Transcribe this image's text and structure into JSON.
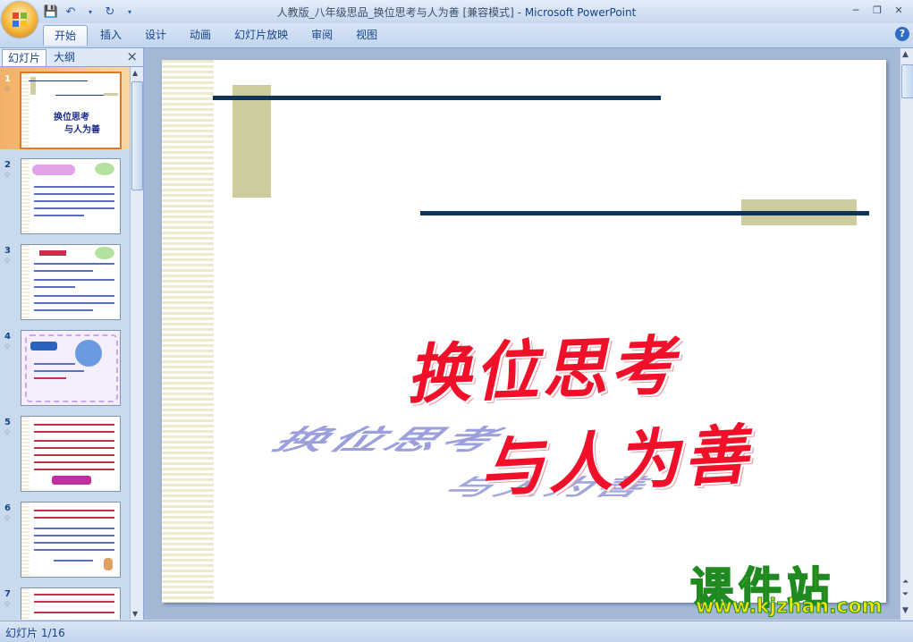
{
  "window": {
    "title": "人教版_八年级思品_换位思考与人为善 [兼容模式]",
    "app_name": "Microsoft PowerPoint"
  },
  "ribbon": {
    "tabs": [
      {
        "label": "开始",
        "active": true
      },
      {
        "label": "插入"
      },
      {
        "label": "设计"
      },
      {
        "label": "动画"
      },
      {
        "label": "幻灯片放映"
      },
      {
        "label": "审阅"
      },
      {
        "label": "视图"
      }
    ]
  },
  "left_panel": {
    "tab_slides": "幻灯片",
    "tab_outline": "大纲",
    "slides": [
      {
        "number": "1",
        "caption": "换位思考 与人为善"
      },
      {
        "number": "2",
        "caption": "案例分析"
      },
      {
        "number": "3",
        "caption": "想一想"
      },
      {
        "number": "4",
        "caption": "七嘴八舌"
      },
      {
        "number": "5",
        "caption": ""
      },
      {
        "number": "6",
        "caption": ""
      },
      {
        "number": "7",
        "caption": ""
      }
    ]
  },
  "slide": {
    "title_line1": "换位思考",
    "title_line2": "与人为善"
  },
  "watermark": {
    "main": "课件站",
    "url": "www.kjzhan.com"
  },
  "status_bar": {
    "slide_indicator": "幻灯片 1/16"
  },
  "colors": {
    "title_red": "#f0102a",
    "bar_navy": "#0e3457",
    "khaki_box": "#cccc9c",
    "selected_thumb": "#f2b066"
  }
}
